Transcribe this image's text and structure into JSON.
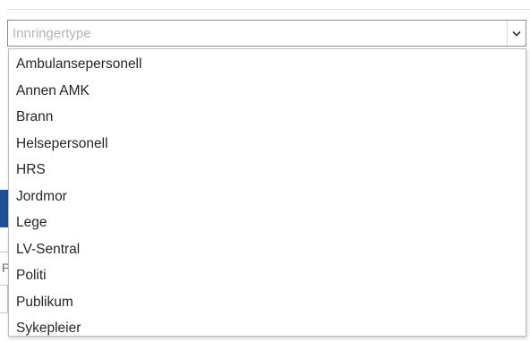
{
  "combo": {
    "placeholder": "Innringertype",
    "arrow_icon": "chevron-down-icon"
  },
  "dropdown": {
    "options": [
      "Ambulansepersonell",
      "Annen AMK",
      "Brann",
      "Helsepersonell",
      "HRS",
      "Jordmor",
      "Lege",
      "LV-Sentral",
      "Politi",
      "Publikum",
      "Sykepleier"
    ]
  },
  "background": {
    "partial_letter": "P"
  },
  "colors": {
    "accent": "#1f4e96",
    "border": "#8a8a8a",
    "placeholder_text": "#b3b3b3",
    "option_text": "#262626"
  }
}
